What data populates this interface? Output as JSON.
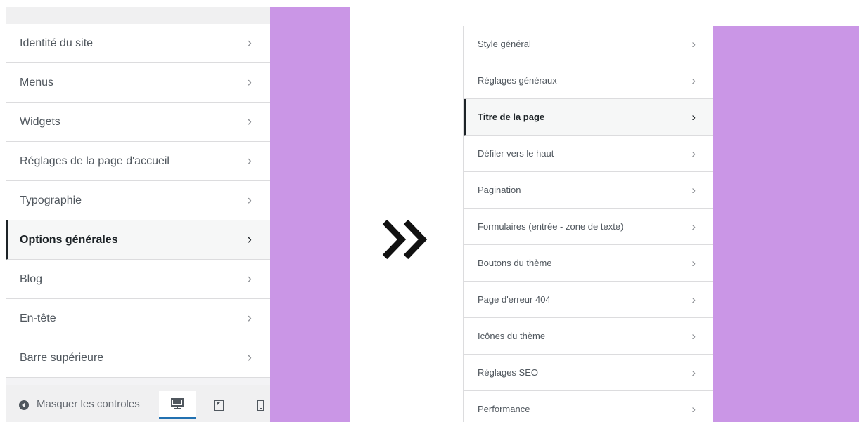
{
  "left_panel": {
    "items": [
      {
        "label": "Identité du site",
        "active": false
      },
      {
        "label": "Menus",
        "active": false
      },
      {
        "label": "Widgets",
        "active": false
      },
      {
        "label": "Réglages de la page d'accueil",
        "active": false
      },
      {
        "label": "Typographie",
        "active": false
      },
      {
        "label": "Options générales",
        "active": true
      },
      {
        "label": "Blog",
        "active": false
      },
      {
        "label": "En-tête",
        "active": false
      },
      {
        "label": "Barre supérieure",
        "active": false
      }
    ],
    "footer": {
      "collapse_label": "Masquer les controles",
      "collapse_icon": "collapse-arrow-icon",
      "devices": [
        {
          "name": "desktop",
          "icon": "desktop-icon",
          "selected": true
        },
        {
          "name": "tablet",
          "icon": "tablet-icon",
          "selected": false
        },
        {
          "name": "mobile",
          "icon": "mobile-icon",
          "selected": false
        }
      ]
    }
  },
  "arrow": {
    "icon": "double-chevron-right-icon"
  },
  "right_panel": {
    "items": [
      {
        "label": "Style général",
        "active": false
      },
      {
        "label": "Réglages généraux",
        "active": false
      },
      {
        "label": "Titre de la page",
        "active": true
      },
      {
        "label": "Défiler vers le haut",
        "active": false
      },
      {
        "label": "Pagination",
        "active": false
      },
      {
        "label": "Formulaires (entrée - zone de texte)",
        "active": false
      },
      {
        "label": "Boutons du thème",
        "active": false
      },
      {
        "label": "Page d'erreur 404",
        "active": false
      },
      {
        "label": "Icônes du thème",
        "active": false
      },
      {
        "label": "Réglages SEO",
        "active": false
      },
      {
        "label": "Performance",
        "active": false
      }
    ]
  },
  "colors": {
    "accent_purple": "#ca96e6",
    "active_border": "#1d2327",
    "text": "#50575e",
    "chevron": "#8c8f94",
    "divider": "#dcdcde",
    "device_selected": "#2271b1"
  }
}
